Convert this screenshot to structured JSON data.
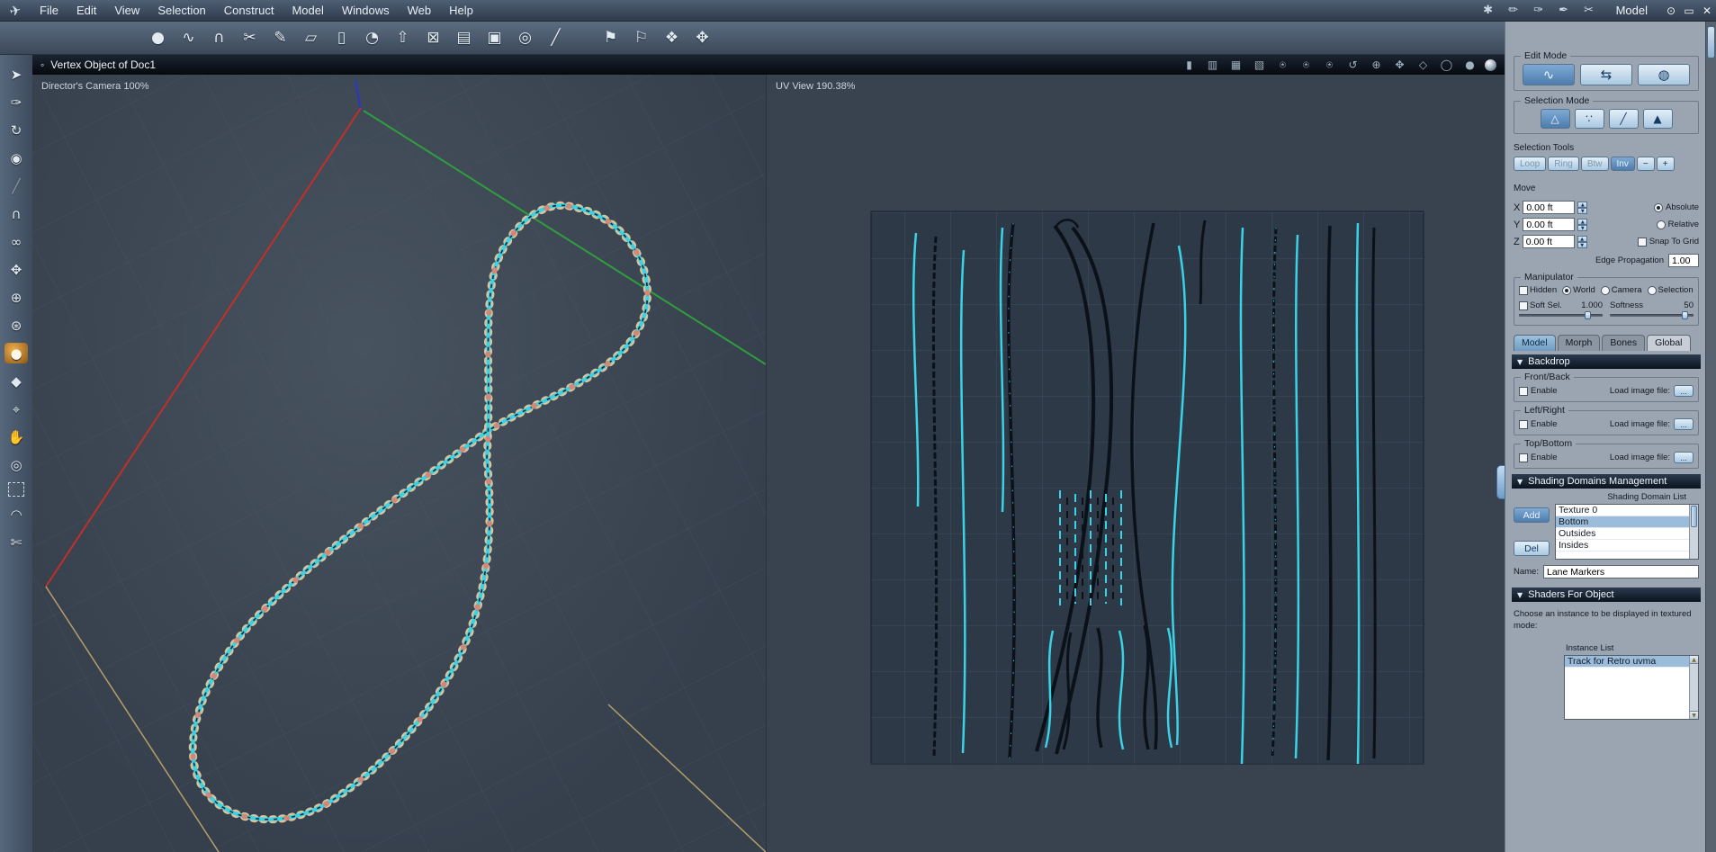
{
  "window": {
    "mode_label": "Model",
    "controls": {
      "minimize": "⊙",
      "maximize": "▭",
      "close": "✕"
    }
  },
  "menubar": {
    "items": [
      "File",
      "Edit",
      "View",
      "Selection",
      "Construct",
      "Model",
      "Windows",
      "Web",
      "Help"
    ]
  },
  "titlebar": {
    "icon": "◦",
    "title": "Vertex Object of Doc1"
  },
  "viewports": {
    "left_label": "Director's Camera 100%",
    "right_label": "UV View 190.38%"
  },
  "icons": {
    "app_logo": "✈",
    "menubar_tools": [
      "✱",
      "✏",
      "✑",
      "✒",
      "✂"
    ],
    "toolbar": [
      "●",
      "∿",
      "∩",
      "✂",
      "✎",
      "▱",
      "▯",
      "◔",
      "⇧",
      "⊠",
      "▤",
      "▣",
      "◎",
      "╱"
    ],
    "toolbar_stamps": [
      "⚑",
      "⚐",
      "❖",
      "✥"
    ],
    "left_strip": [
      "➤",
      "✑",
      "↻",
      "◉",
      "╱",
      "∩",
      "∞",
      "✥",
      "⊕",
      "⊛",
      "●",
      "◆",
      "⌖",
      "✋",
      "◎",
      "▢",
      "◠",
      "✄"
    ],
    "titlebar_right": [
      "▮",
      "▥",
      "▦",
      "▧",
      "⍟",
      "⍟",
      "⍟",
      "↺",
      "⊕",
      "✥",
      "◇",
      "◯",
      "●"
    ],
    "collapse_triangle": "▼",
    "stepper_up": "▲",
    "stepper_down": "▼",
    "scroll_up": "▲",
    "scroll_down": "▼",
    "edit_mode_glyphs": [
      "∿",
      "⇆",
      "◍"
    ],
    "selection_mode_glyphs": [
      "△",
      "∵",
      "╱",
      "▲"
    ],
    "selection_extra": [
      "−",
      "+"
    ]
  },
  "panel": {
    "edit_mode": {
      "title": "Edit Mode"
    },
    "selection_mode": {
      "title": "Selection Mode"
    },
    "selection_tools": {
      "title": "Selection Tools",
      "buttons": [
        "Loop",
        "Ring",
        "Btw",
        "Inv"
      ]
    },
    "move": {
      "title": "Move",
      "axes": [
        {
          "label": "X",
          "value": "0.00 ft"
        },
        {
          "label": "Y",
          "value": "0.00 ft"
        },
        {
          "label": "Z",
          "value": "0.00 ft"
        }
      ],
      "absolute": "Absolute",
      "relative": "Relative",
      "snap": "Snap To Grid",
      "edge_prop_label": "Edge Propagation",
      "edge_prop_value": "1.00"
    },
    "manipulator": {
      "title": "Manipulator",
      "hidden": "Hidden",
      "world": "World",
      "camera": "Camera",
      "selection": "Selection",
      "soft_sel": "Soft Sel.",
      "soft_sel_value": "1.000",
      "softness": "Softness",
      "softness_value": "50"
    },
    "tabs": [
      "Model",
      "Morph",
      "Bones",
      "Global"
    ],
    "backdrop": {
      "title": "Backdrop",
      "enable": "Enable",
      "load": "Load image file:",
      "browse": "...",
      "groups": [
        "Front/Back",
        "Left/Right",
        "Top/Bottom"
      ]
    },
    "shading": {
      "title": "Shading Domains Management",
      "list_label": "Shading Domain List",
      "add": "Add",
      "del": "Del",
      "items": [
        "Texture 0",
        "Bottom",
        "Outsides",
        "Insides"
      ],
      "name_label": "Name:",
      "name_value": "Lane Markers"
    },
    "shaders": {
      "title": "Shaders For Object",
      "description": "Choose an instance to be displayed in textured mode:",
      "list_label": "Instance List",
      "items": [
        "Track for Retro uvma"
      ]
    }
  }
}
